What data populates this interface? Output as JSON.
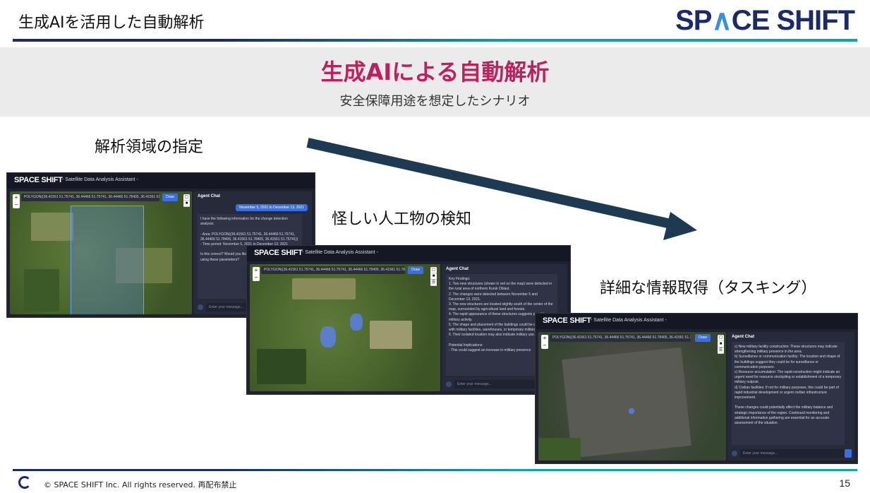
{
  "header": {
    "title": "生成AIを活用した自動解析",
    "logo": "SPACE SHIFT"
  },
  "banner": {
    "title": "生成AIによる自動解析",
    "subtitle": "安全保障用途を想定したシナリオ"
  },
  "steps": [
    {
      "label": "解析領域の指定"
    },
    {
      "label": "怪しい人工物の検知"
    },
    {
      "label": "詳細な情報取得（タスキング）"
    }
  ],
  "app": {
    "logo": "SPACE SHIFT",
    "subtitle": "- Satellite Data Analysis Assistant -",
    "polygon": "POLYGON((36.41561 51.75741, 36.44466 51.75741, 36.44466 51.78405, 36.41561 51.78405, 36.41561 51.757",
    "draw_label": "Draw",
    "chat_title": "Agent Chat",
    "input_placeholder": "Enter your message...",
    "zoom_in": "+",
    "zoom_out": "−"
  },
  "screens": [
    {
      "user_msg": "November 5, 2021 to December 13, 2021",
      "body": "I have the following information for the change detection analysis:\n\n- Area: POLYGON((36.41561 51.75741, 36.44466 51.75741, 36.44466 51.78405, 36.41561 51.78405, 36.41561 51.75741))\n- Time period: November 5, 2021 to December 13, 2021\n\nIs this correct? Would you like me to proceed with the analysis using these parameters?"
    },
    {
      "body": "Key Findings:\n1. Two new structures (shown in red on the map) were detected in the rural area of northern Kursk Oblast.\n2. The changes were detected between November 5 and December 13, 2021.\n3. The new structures are located slightly south of the center of the map, surrounded by agricultural land and forests.\n4. The rapid appearance of these structures suggests possible military activity.\n5. The shape and placement of the buildings could be consistent with military facilities, warehouses, or temporary military outposts.\n6. Their isolated location may also indicate military use.\n\nPotential Implications:\n- This could suggest an increase in military presence"
    },
    {
      "body": "c) New military facility construction: These structures may indicate strengthening military presence in the area.\nb) Surveillance or communication facility: The location and shape of the buildings suggest they could be for surveillance or communication purposes.\nc) Resource accumulation: The rapid construction might indicate an urgent need for resource stockpiling or establishment of a temporary military outpost.\nd) Civilian facilities: If not for military purposes, this could be part of rapid industrial development or urgent civilian infrastructure improvement.\n\nThese changes could potentially affect the military balance and strategic importance of the region. Continued monitoring and additional information gathering are essential for an accurate assessment of the situation."
    }
  ],
  "footer": {
    "copyright": "© SPACE SHIFT Inc. All rights reserved. 再配布禁止",
    "page": "15"
  },
  "colors": {
    "navy": "#1b2a6b",
    "teal": "#15a3a6",
    "accent": "#c01f5d",
    "arrow": "#1d3a52"
  }
}
